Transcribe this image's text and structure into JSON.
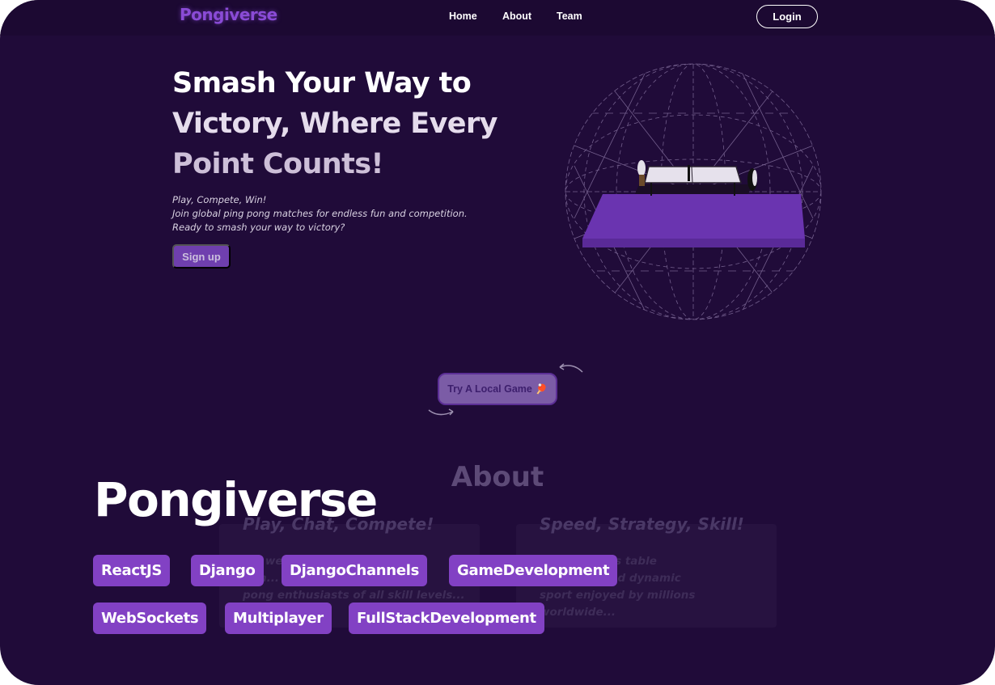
{
  "nav": {
    "logo": "Pongiverse",
    "links": [
      "Home",
      "About",
      "Team"
    ],
    "login_label": "Login"
  },
  "hero": {
    "title_lines": [
      "Smash Your Way to",
      "Victory, Where Every",
      "Point Counts!"
    ],
    "subtitle_lines": [
      "Play, Compete, Win!",
      "Join global ping pong matches for endless fun and competition.",
      "Ready to smash your way to victory?"
    ],
    "signup_label": "Sign up",
    "globe_graphic": "wireframe-sphere-with-ping-pong-table"
  },
  "local_game": {
    "label": "Try A Local Game",
    "icon": "ping-pong-paddle-icon"
  },
  "about": {
    "heading": "About",
    "cards": [
      {
        "title": "Play, Chat, Compete!",
        "text_lines": [
          "We web...",
          "...in...",
          "pong enthusiasts of all skill levels..."
        ]
      },
      {
        "title": "Speed, Strategy, Skill!",
        "text_lines": [
          "...o known as table",
          "...t-paced and dynamic",
          "sport enjoyed by millions",
          "worldwide..."
        ]
      }
    ]
  },
  "overlay": {
    "title": "Pongiverse",
    "tags": [
      "ReactJS",
      "Django",
      "DjangoChannels",
      "GameDevelopment",
      "WebSockets",
      "Multiplayer",
      "FullStackDevelopment"
    ]
  },
  "colors": {
    "background": "#200b39",
    "accent": "#8241c4",
    "logo": "#8a4bd6"
  }
}
